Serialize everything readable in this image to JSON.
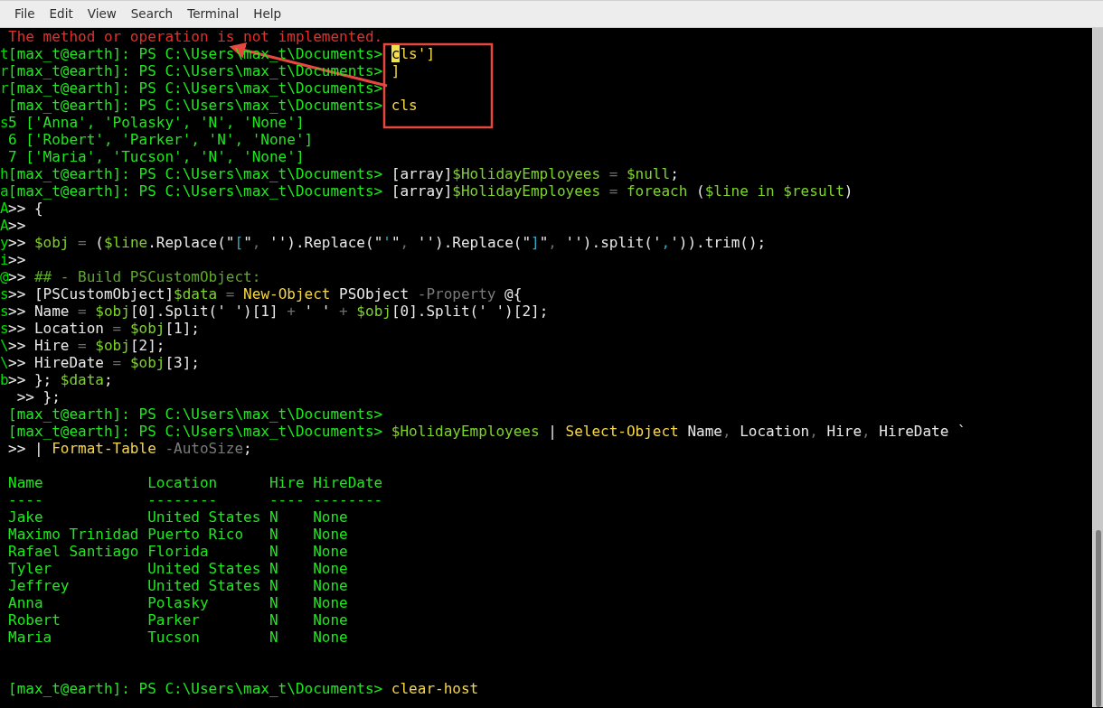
{
  "menu": [
    {
      "label": "File"
    },
    {
      "label": "Edit"
    },
    {
      "label": "View"
    },
    {
      "label": "Search"
    },
    {
      "label": "Terminal"
    },
    {
      "label": "Help"
    }
  ],
  "annotations": [
    {
      "kind": "box"
    },
    {
      "kind": "arrow"
    }
  ],
  "lines": [
    {
      "segments": [
        {
          "kind": "error",
          "text": "The method or operation is not implemented."
        }
      ]
    },
    {
      "residue": "t",
      "segments": [
        {
          "kind": "prompt",
          "text": "[max_t@earth]: PS C:\\Users\\max_t\\Documents> "
        },
        {
          "kind": "cursor",
          "text": "c"
        },
        {
          "kind": "input",
          "text": "ls']"
        }
      ]
    },
    {
      "residue": "r",
      "segments": [
        {
          "kind": "prompt",
          "text": "[max_t@earth]: PS C:\\Users\\max_t\\Documents> "
        },
        {
          "kind": "input",
          "text": "]"
        }
      ]
    },
    {
      "residue": "r",
      "segments": [
        {
          "kind": "prompt",
          "text": "[max_t@earth]: PS C:\\Users\\max_t\\Documents>"
        }
      ]
    },
    {
      "segments": [
        {
          "kind": "prompt",
          "text": "[max_t@earth]: PS C:\\Users\\max_t\\Documents> "
        },
        {
          "kind": "input",
          "text": "cls"
        }
      ]
    },
    {
      "residue": "s",
      "segments": [
        {
          "kind": "output",
          "text": "5 ['Anna', 'Polasky', 'N', 'None']"
        }
      ]
    },
    {
      "segments": [
        {
          "kind": "output",
          "text": "6 ['Robert', 'Parker', 'N', 'None']"
        }
      ]
    },
    {
      "segments": [
        {
          "kind": "output",
          "text": "7 ['Maria', 'Tucson', 'N', 'None']"
        }
      ]
    },
    {
      "residue": "h",
      "segments": [
        {
          "kind": "prompt",
          "text": "[max_t@earth]: PS C:\\Users\\max_t\\Documents> "
        },
        {
          "kind": "text",
          "text": "[array]"
        },
        {
          "kind": "var",
          "text": "$HolidayEmployees"
        },
        {
          "kind": "op",
          "text": " = "
        },
        {
          "kind": "var",
          "text": "$null"
        },
        {
          "kind": "text",
          "text": ";"
        }
      ]
    },
    {
      "residue": "a",
      "segments": [
        {
          "kind": "prompt",
          "text": "[max_t@earth]: PS C:\\Users\\max_t\\Documents> "
        },
        {
          "kind": "text",
          "text": "[array]"
        },
        {
          "kind": "var",
          "text": "$HolidayEmployees"
        },
        {
          "kind": "op",
          "text": " = "
        },
        {
          "kind": "var",
          "text": "foreach"
        },
        {
          "kind": "text",
          "text": " ("
        },
        {
          "kind": "var",
          "text": "$line in $result"
        },
        {
          "kind": "text",
          "text": ")"
        }
      ]
    },
    {
      "residue": "A",
      "segments": [
        {
          "kind": "text",
          "text": ">> {"
        }
      ]
    },
    {
      "residue": "A",
      "segments": [
        {
          "kind": "text",
          "text": ">>"
        }
      ]
    },
    {
      "residue": "y",
      "segments": [
        {
          "kind": "text",
          "text": ">> "
        },
        {
          "kind": "var",
          "text": "$obj"
        },
        {
          "kind": "op",
          "text": " = "
        },
        {
          "kind": "text",
          "text": "("
        },
        {
          "kind": "var",
          "text": "$line"
        },
        {
          "kind": "text",
          "text": ".Replace(\""
        },
        {
          "kind": "str",
          "text": "["
        },
        {
          "kind": "text",
          "text": "\""
        },
        {
          "kind": "op",
          "text": ", "
        },
        {
          "kind": "text",
          "text": "'').Replace(\""
        },
        {
          "kind": "str",
          "text": "'"
        },
        {
          "kind": "text",
          "text": "\""
        },
        {
          "kind": "op",
          "text": ", "
        },
        {
          "kind": "text",
          "text": "'').Replace(\""
        },
        {
          "kind": "str",
          "text": "]"
        },
        {
          "kind": "text",
          "text": "\""
        },
        {
          "kind": "op",
          "text": ", "
        },
        {
          "kind": "text",
          "text": "'').split('"
        },
        {
          "kind": "str",
          "text": ","
        },
        {
          "kind": "text",
          "text": "')).trim();"
        }
      ]
    },
    {
      "residue": "i",
      "segments": [
        {
          "kind": "text",
          "text": ">>"
        }
      ]
    },
    {
      "residue": "@",
      "segments": [
        {
          "kind": "text",
          "text": ">> "
        },
        {
          "kind": "comment",
          "text": "## - Build PSCustomObject:"
        }
      ]
    },
    {
      "residue": "s",
      "segments": [
        {
          "kind": "text",
          "text": ">> [PSCustomObject]"
        },
        {
          "kind": "var",
          "text": "$data"
        },
        {
          "kind": "op",
          "text": " = "
        },
        {
          "kind": "cmd",
          "text": "New-Object"
        },
        {
          "kind": "text",
          "text": " PSObject "
        },
        {
          "kind": "param",
          "text": "-Property"
        },
        {
          "kind": "text",
          "text": " @{"
        }
      ]
    },
    {
      "residue": "s",
      "segments": [
        {
          "kind": "text",
          "text": ">> Name"
        },
        {
          "kind": "op",
          "text": " = "
        },
        {
          "kind": "var",
          "text": "$obj"
        },
        {
          "kind": "text",
          "text": "[0].Split(' ')[1]"
        },
        {
          "kind": "op",
          "text": " + "
        },
        {
          "kind": "text",
          "text": "' '"
        },
        {
          "kind": "op",
          "text": " + "
        },
        {
          "kind": "var",
          "text": "$obj"
        },
        {
          "kind": "text",
          "text": "[0].Split(' ')[2];"
        }
      ]
    },
    {
      "residue": "s",
      "segments": [
        {
          "kind": "text",
          "text": ">> Location"
        },
        {
          "kind": "op",
          "text": " = "
        },
        {
          "kind": "var",
          "text": "$obj"
        },
        {
          "kind": "text",
          "text": "[1];"
        }
      ]
    },
    {
      "residue": "\\",
      "segments": [
        {
          "kind": "text",
          "text": ">> Hire"
        },
        {
          "kind": "op",
          "text": " = "
        },
        {
          "kind": "var",
          "text": "$obj"
        },
        {
          "kind": "text",
          "text": "[2];"
        }
      ]
    },
    {
      "residue": "\\",
      "segments": [
        {
          "kind": "text",
          "text": ">> HireDate"
        },
        {
          "kind": "op",
          "text": " = "
        },
        {
          "kind": "var",
          "text": "$obj"
        },
        {
          "kind": "text",
          "text": "[3];"
        }
      ]
    },
    {
      "residue": "b",
      "segments": [
        {
          "kind": "text",
          "text": ">> }; "
        },
        {
          "kind": "var",
          "text": "$data"
        },
        {
          "kind": "text",
          "text": ";"
        }
      ]
    },
    {
      "segments": [
        {
          "kind": "text",
          "text": " >> };"
        }
      ]
    },
    {
      "segments": [
        {
          "kind": "prompt",
          "text": "[max_t@earth]: PS C:\\Users\\max_t\\Documents>"
        }
      ]
    },
    {
      "segments": [
        {
          "kind": "prompt",
          "text": "[max_t@earth]: PS C:\\Users\\max_t\\Documents> "
        },
        {
          "kind": "var",
          "text": "$HolidayEmployees"
        },
        {
          "kind": "text",
          "text": " | "
        },
        {
          "kind": "cmd",
          "text": "Select-Object"
        },
        {
          "kind": "text",
          "text": " Name"
        },
        {
          "kind": "op",
          "text": ", "
        },
        {
          "kind": "text",
          "text": "Location"
        },
        {
          "kind": "op",
          "text": ", "
        },
        {
          "kind": "text",
          "text": "Hire"
        },
        {
          "kind": "op",
          "text": ", "
        },
        {
          "kind": "text",
          "text": "HireDate `"
        }
      ]
    },
    {
      "segments": [
        {
          "kind": "text",
          "text": ">> | "
        },
        {
          "kind": "cmd",
          "text": "Format-Table"
        },
        {
          "kind": "param",
          "text": " -AutoSize"
        },
        {
          "kind": "text",
          "text": ";"
        }
      ]
    },
    {
      "kind": "blank"
    },
    {
      "segments": [
        {
          "kind": "output",
          "text": "Name            Location      Hire HireDate"
        }
      ]
    },
    {
      "segments": [
        {
          "kind": "output",
          "text": "----            --------      ---- --------"
        }
      ]
    },
    {
      "segments": [
        {
          "kind": "output",
          "text": "Jake            United States N    None"
        }
      ]
    },
    {
      "segments": [
        {
          "kind": "output",
          "text": "Maximo Trinidad Puerto Rico   N    None"
        }
      ]
    },
    {
      "segments": [
        {
          "kind": "output",
          "text": "Rafael Santiago Florida       N    None"
        }
      ]
    },
    {
      "segments": [
        {
          "kind": "output",
          "text": "Tyler           United States N    None"
        }
      ]
    },
    {
      "segments": [
        {
          "kind": "output",
          "text": "Jeffrey         United States N    None"
        }
      ]
    },
    {
      "segments": [
        {
          "kind": "output",
          "text": "Anna            Polasky       N    None"
        }
      ]
    },
    {
      "segments": [
        {
          "kind": "output",
          "text": "Robert          Parker        N    None"
        }
      ]
    },
    {
      "segments": [
        {
          "kind": "output",
          "text": "Maria           Tucson        N    None"
        }
      ]
    },
    {
      "kind": "blank"
    },
    {
      "kind": "blank"
    },
    {
      "segments": [
        {
          "kind": "prompt",
          "text": "[max_t@earth]: PS C:\\Users\\max_t\\Documents> "
        },
        {
          "kind": "input",
          "text": "clear-host"
        }
      ]
    }
  ]
}
